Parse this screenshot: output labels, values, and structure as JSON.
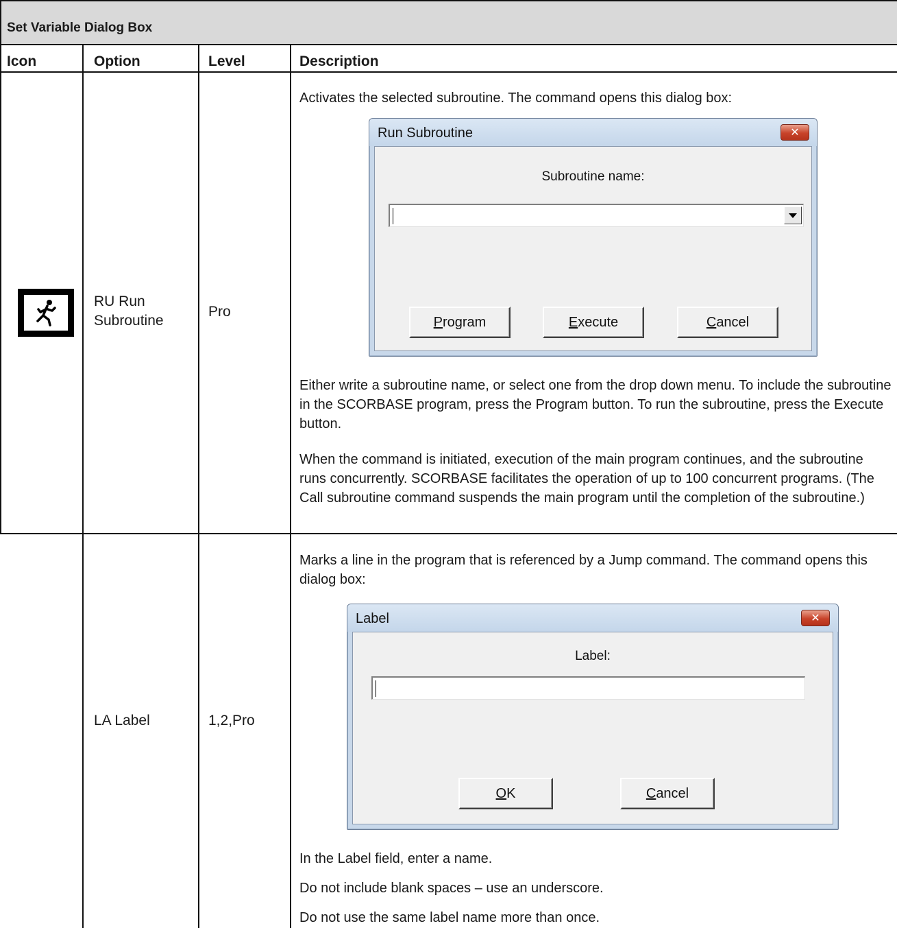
{
  "table": {
    "title": "Set Variable Dialog Box",
    "headers": {
      "icon": "Icon",
      "option": "Option",
      "level": "Level",
      "description": "Description"
    }
  },
  "rows": [
    {
      "icon": "running-man-icon",
      "option_line1": "RU Run",
      "option_line2": "Subroutine",
      "level": "Pro",
      "intro": "Activates the selected subroutine. The command opens this dialog box:",
      "dialog": {
        "title": "Run Subroutine",
        "label": "Subroutine name:",
        "input_value": "",
        "buttons": [
          {
            "mnemonic": "P",
            "rest": "rogram"
          },
          {
            "mnemonic": "E",
            "rest": "xecute"
          },
          {
            "mnemonic": "C",
            "rest": "ancel"
          }
        ]
      },
      "para1": "Either write a subroutine name, or select one from the drop down menu. To include the subroutine in the SCORBASE program, press the Program button. To run the subroutine, press the Execute button.",
      "para2": "When the command is initiated, execution of the main program continues, and the subroutine runs concurrently. SCORBASE facilitates the operation of up to 100 concurrent programs. (The Call subroutine command suspends the main program until the completion of the subroutine.)"
    },
    {
      "option": "LA Label",
      "level": "1,2,Pro",
      "intro": "Marks a line in the program that is referenced by a Jump command. The command opens this dialog box:",
      "dialog": {
        "title": "Label",
        "label": "Label:",
        "input_value": "",
        "buttons": [
          {
            "mnemonic": "O",
            "rest": "K"
          },
          {
            "mnemonic": "C",
            "rest": "ancel"
          }
        ]
      },
      "para1": "In the Label field, enter a name.",
      "para2": "Do not include blank spaces – use an underscore.",
      "para3": "Do not use the same label name more than once."
    }
  ]
}
